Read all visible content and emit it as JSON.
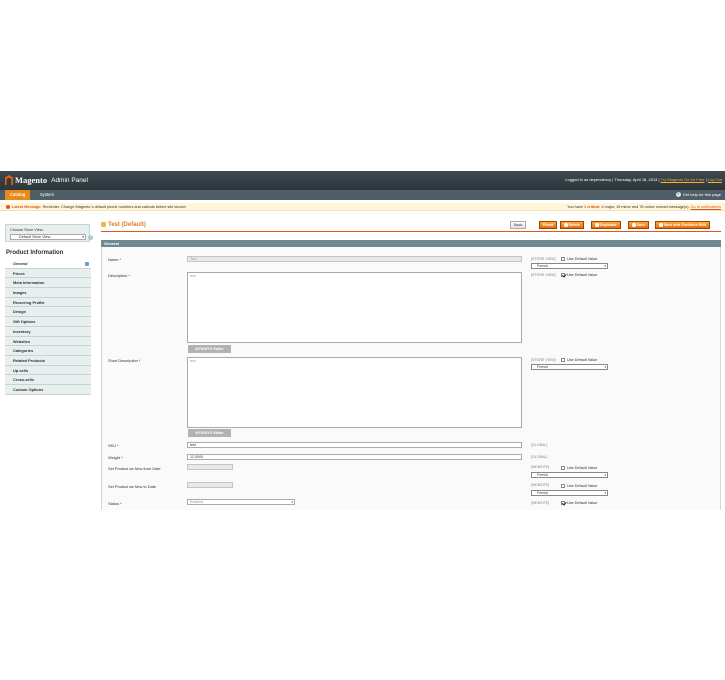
{
  "header": {
    "brand": "Magento",
    "subtitle": "Admin Panel",
    "logged_in": "Logged in as dependency",
    "date": "Thursday, April 18, 2013",
    "try_link": "Try Magento Go for Free",
    "logout": "Log Out"
  },
  "nav": {
    "tabs": [
      {
        "label": "Catalog"
      },
      {
        "label": "System"
      }
    ],
    "help": "Get help for this page"
  },
  "notice": {
    "label": "Latest Message:",
    "text": "Reminder: Change Magento`s default phone numbers and callouts before site launch",
    "summary_prefix": "You have",
    "critical": "1 critical",
    "summary_rest": ", 4 major, 19 minor and 78 notice unread message(s).",
    "link": "Go to notifications"
  },
  "store_view": {
    "label": "Choose Store View:",
    "value": "Default Store View",
    "help": "?"
  },
  "sidebar": {
    "title": "Product Information",
    "items": [
      {
        "label": "General"
      },
      {
        "label": "Prices"
      },
      {
        "label": "Meta Information"
      },
      {
        "label": "Images"
      },
      {
        "label": "Recurring Profile"
      },
      {
        "label": "Design"
      },
      {
        "label": "Gift Options"
      },
      {
        "label": "Inventory"
      },
      {
        "label": "Websites"
      },
      {
        "label": "Categories"
      },
      {
        "label": "Related Products"
      },
      {
        "label": "Up-sells"
      },
      {
        "label": "Cross-sells"
      },
      {
        "label": "Custom Options"
      }
    ]
  },
  "page": {
    "title": "Test (Default)",
    "buttons": {
      "back": "Back",
      "reset": "Reset",
      "delete": "Delete",
      "duplicate": "Duplicate",
      "save": "Save",
      "save_continue": "Save and Continue Edit"
    },
    "section": "General"
  },
  "form": {
    "name_label": "Name *",
    "name_value": "Test",
    "description_label": "Description *",
    "description_value": "test",
    "short_description_label": "Short Description *",
    "short_description_value": "test",
    "wysiwyg": "WYSIWYG Editor",
    "sku_label": "SKU *",
    "sku_value": "test",
    "weight_label": "Weight *",
    "weight_value": "12.0000",
    "new_from_label": "Set Product as New from Date",
    "new_to_label": "Set Product as New to Date",
    "status_label": "Status *",
    "status_value": "Enabled",
    "scope_store": "[STORE VIEW]",
    "scope_global": "[GLOBAL]",
    "scope_website": "[WEBSITE]",
    "use_default": "Use Default Value",
    "lang": "French"
  },
  "colors": {
    "accent": "#e27c21",
    "header_bg": "#2c373b",
    "nav_active": "#e88a17",
    "section_bg": "#6f8992"
  }
}
